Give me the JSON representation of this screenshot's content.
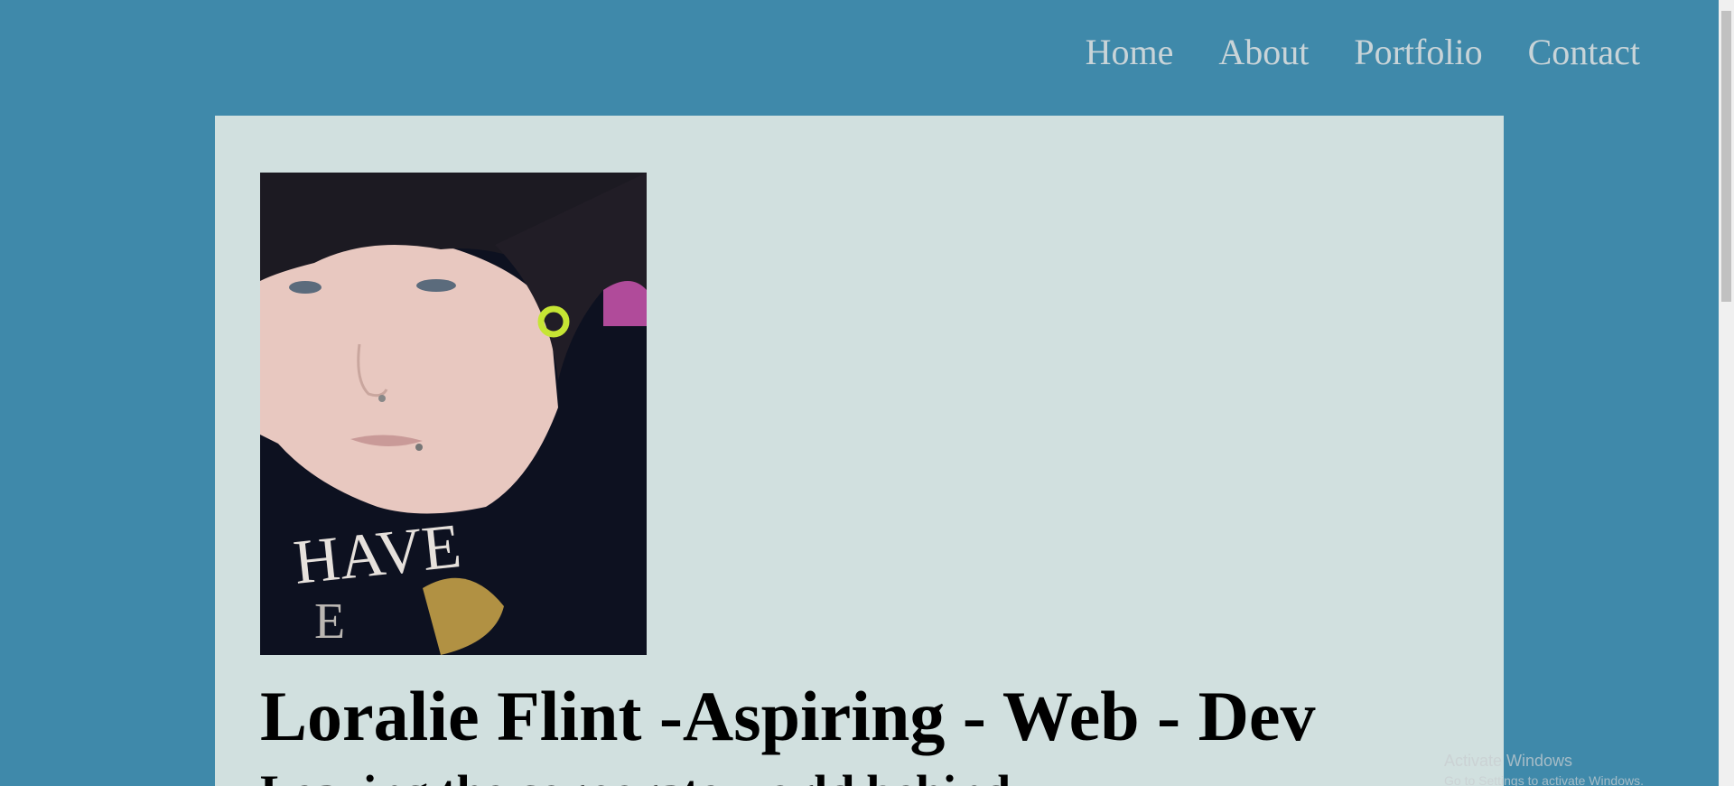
{
  "nav": {
    "items": [
      {
        "label": "Home"
      },
      {
        "label": "About"
      },
      {
        "label": "Portfolio"
      },
      {
        "label": "Contact"
      }
    ]
  },
  "hero": {
    "photo_icon": "profile-photo",
    "title": "Loralie Flint -Aspiring - Web - Dev",
    "subtitle": "Leaving the corporate world behind"
  },
  "watermark": {
    "line1": "Activate Windows",
    "line2": "Go to Settings to activate Windows."
  }
}
